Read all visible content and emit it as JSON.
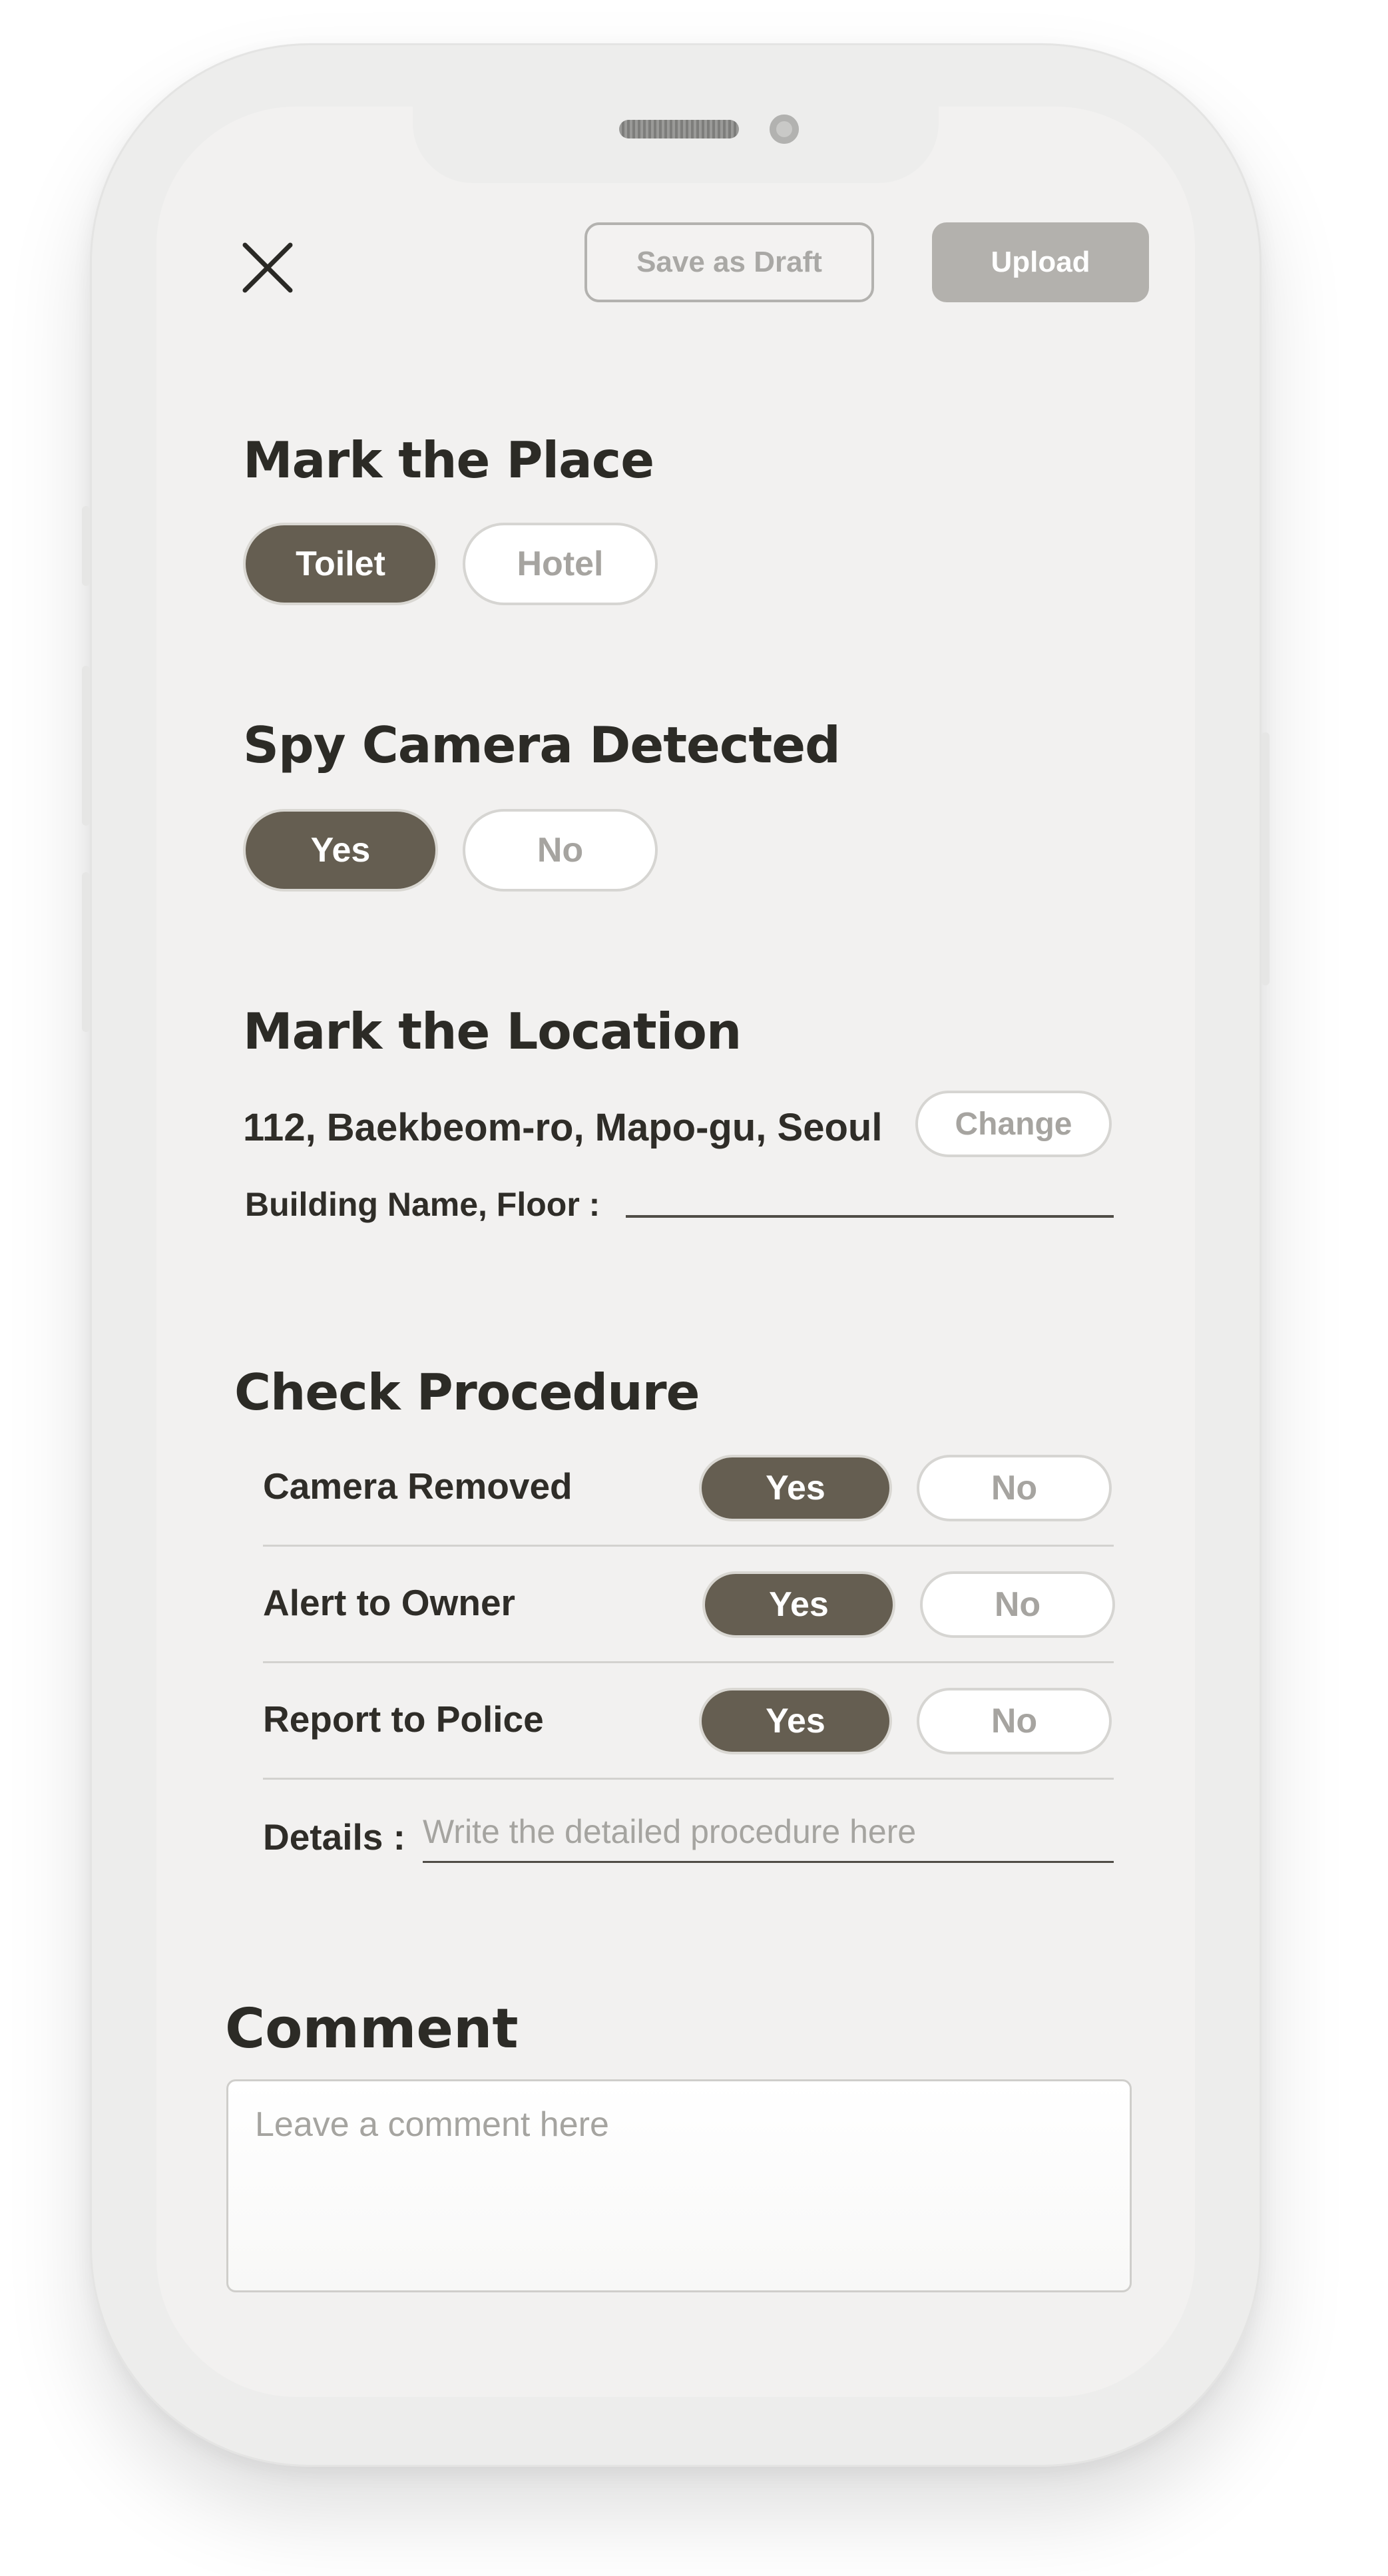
{
  "toolbar": {
    "save_draft_label": "Save as Draft",
    "upload_label": "Upload"
  },
  "place": {
    "title": "Mark the Place",
    "options": [
      "Toilet",
      "Hotel"
    ],
    "selected": "Toilet"
  },
  "spy_camera": {
    "title": "Spy Camera Detected",
    "options": [
      "Yes",
      "No"
    ],
    "selected": "Yes"
  },
  "location": {
    "title": "Mark the Location",
    "address": "112, Baekbeom-ro, Mapo-gu, Seoul",
    "change_label": "Change",
    "building_label": "Building Name, Floor :",
    "building_value": ""
  },
  "procedure": {
    "title": "Check Procedure",
    "rows": [
      {
        "label": "Camera Removed",
        "yes": "Yes",
        "no": "No",
        "selected": "Yes"
      },
      {
        "label": "Alert to Owner",
        "yes": "Yes",
        "no": "No",
        "selected": "Yes"
      },
      {
        "label": "Report to Police",
        "yes": "Yes",
        "no": "No",
        "selected": "Yes"
      }
    ],
    "details_label": "Details :",
    "details_placeholder": "Write the detailed procedure here"
  },
  "comment": {
    "title": "Comment",
    "placeholder": "Leave a comment here"
  },
  "colors": {
    "selected_pill": "#655e51",
    "upload_button": "#b3b1ad",
    "screen_background": "#f2f1f0",
    "heading_text": "#2c2b26"
  }
}
